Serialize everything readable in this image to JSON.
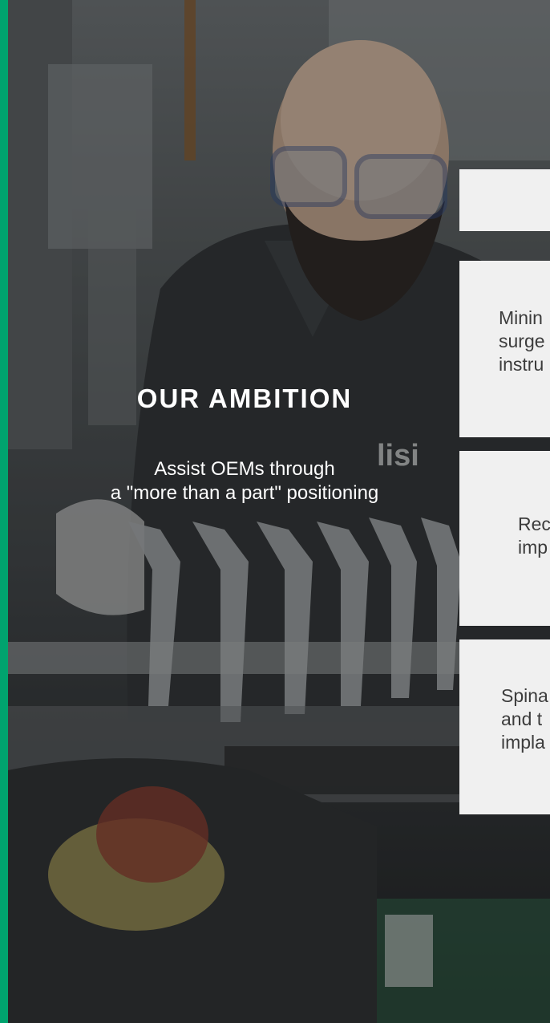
{
  "accent_color": "#00a36e",
  "card_background": "#f0f0f0",
  "hero": {
    "title": "OUR AMBITION",
    "subtitle_line1": "Assist OEMs through",
    "subtitle_line2": "a \"more than a part\" positioning"
  },
  "cards": [
    {
      "lines": [
        "Minin",
        "surge",
        "instru"
      ]
    },
    {
      "lines": [
        "Rec",
        "imp"
      ]
    },
    {
      "lines": [
        "Spina",
        "and t",
        "impla"
      ]
    }
  ],
  "photo": {
    "badge_text": "lisi",
    "icon": "factory-worker-photo"
  }
}
